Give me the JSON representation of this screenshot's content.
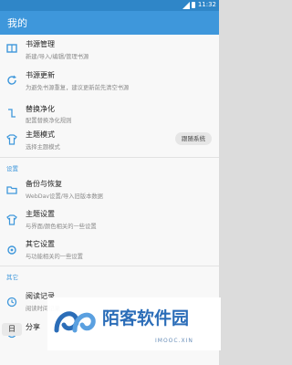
{
  "status_bar": {
    "time": "11:32"
  },
  "app_bar": {
    "title": "我的"
  },
  "main_items": [
    {
      "title": "书源管理",
      "subtitle": "新建/导入/编辑/管理书源",
      "icon": "bookshelf-icon"
    },
    {
      "title": "书源更新",
      "subtitle": "为避免书源重复，建议更新前先清空书源",
      "icon": "refresh-icon"
    },
    {
      "title": "替换净化",
      "subtitle": "配置替换净化规则",
      "icon": "replace-icon"
    },
    {
      "title": "主题模式",
      "subtitle": "选择主题模式",
      "icon": "shirt-icon",
      "pill": "跟随系统"
    }
  ],
  "sections": {
    "settings": "设置",
    "other": "其它"
  },
  "settings_items": [
    {
      "title": "备份与恢复",
      "subtitle": "WebDav设置/导入旧版本数据",
      "icon": "folder-icon"
    },
    {
      "title": "主题设置",
      "subtitle": "与界面/颜色相关的一些设置",
      "icon": "shirt-icon"
    },
    {
      "title": "其它设置",
      "subtitle": "与功能相关的一些设置",
      "icon": "gear-icon"
    }
  ],
  "other_items": [
    {
      "title": "阅读记录",
      "subtitle": "阅读时间记录",
      "icon": "clock-icon"
    },
    {
      "title": "分享",
      "subtitle": "",
      "icon": "share-icon"
    }
  ],
  "bottom_button": {
    "label": "日"
  },
  "watermark": {
    "text": "陌客软件园",
    "url": "IMOOC.XIN"
  },
  "colors": {
    "accent": "#3e97db",
    "status_bar": "#2f86c8"
  }
}
